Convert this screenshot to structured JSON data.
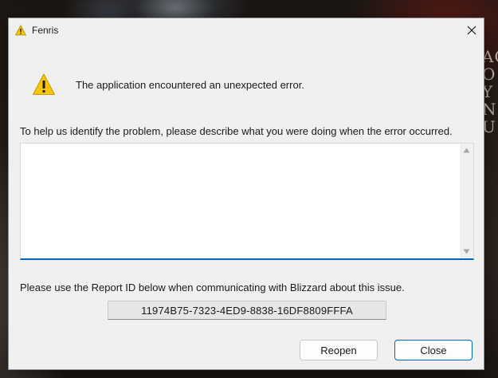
{
  "window": {
    "title": "Fenris"
  },
  "background": {
    "side_text": "AC O Y N U"
  },
  "dialog": {
    "message": "The application encountered an unexpected error.",
    "describe_prompt": "To help us identify the problem, please describe what you were doing when the error occurred.",
    "description_value": "",
    "report_prompt": "Please use the Report ID below when communicating with Blizzard about this issue.",
    "report_id": "11974B75-7323-4ED9-8838-16DF8809FFFA"
  },
  "buttons": {
    "reopen_label": "Reopen",
    "close_label": "Close"
  },
  "icons": {
    "title": "warning-icon",
    "message": "warning-icon",
    "close": "close-icon"
  },
  "colors": {
    "accent": "#0067c0",
    "warning_fill": "#f7c600",
    "dialog_bg": "#f0f0f0"
  }
}
